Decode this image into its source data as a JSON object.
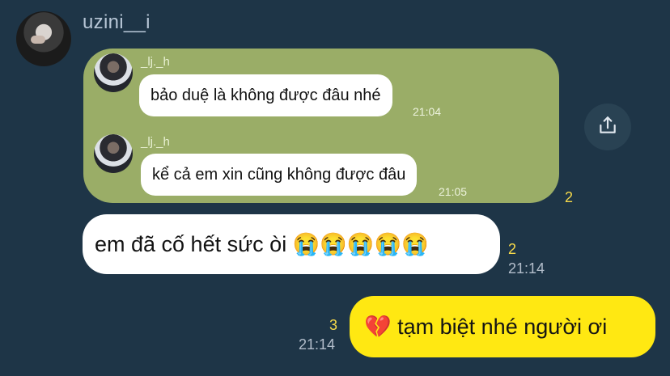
{
  "header": {
    "username": "uzini__i"
  },
  "forwarded": {
    "messages": [
      {
        "sender": "_lj._h",
        "text": "bảo duệ là không được đâu nhé",
        "time": "21:04"
      },
      {
        "sender": "_lj._h",
        "text": "kể cả em xin cũng không được đâu",
        "time": "21:05"
      }
    ],
    "count": "2"
  },
  "incoming": {
    "text": "em đã cố hết sức òi 😭😭😭😭😭",
    "count": "2",
    "time": "21:14"
  },
  "outgoing": {
    "text": "💔 tạm biệt nhé người ơi",
    "count": "3",
    "time": "21:14"
  },
  "icons": {
    "share": "share-icon"
  },
  "colors": {
    "background": "#1e3547",
    "forward_box": "#9aad67",
    "outgoing_bubble": "#ffe812",
    "count_yellow": "#f6d94a"
  }
}
